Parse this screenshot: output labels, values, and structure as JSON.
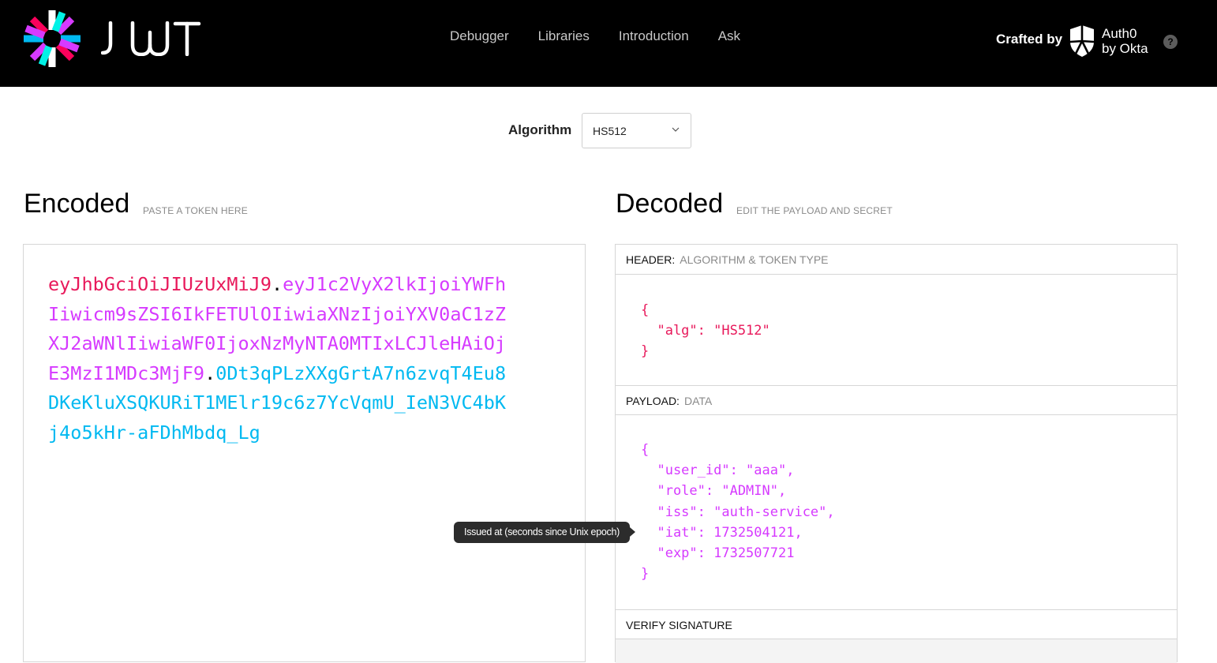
{
  "brand": {
    "wordmark": "JWT"
  },
  "nav": [
    {
      "label": "Debugger"
    },
    {
      "label": "Libraries"
    },
    {
      "label": "Introduction"
    },
    {
      "label": "Ask"
    }
  ],
  "credit": {
    "prefix": "Crafted by",
    "name_line1": "Auth0",
    "name_line2": "by Okta",
    "help": "?"
  },
  "algorithm": {
    "label": "Algorithm",
    "selected": "HS512"
  },
  "encoded": {
    "title": "Encoded",
    "subtitle": "PASTE A TOKEN HERE",
    "token_header": "eyJhbGciOiJIUzUxMiJ9",
    "token_payload": "eyJ1c2VyX2lkIjoiYWFhIiwicm9sZSI6IkFETUlOIiwiaXNzIjoiYXV0aC1zZXJ2aWNlIiwiaWF0IjoxNzMyNTA0MTIxLCJleHAiOjE3MzI1MDc3MjF9",
    "token_signature": "0Dt3qPLzXXgGrtA7n6zvqT4Eu8DKeKluXSQKURiT1MElr19c6z7YcVqmU_IeN3VC4bKj4o5kHr-aFDhMbdq_Lg",
    "separator": "."
  },
  "decoded": {
    "title": "Decoded",
    "subtitle": "EDIT THE PAYLOAD AND SECRET",
    "header_section": {
      "label": "HEADER:",
      "sublabel": "ALGORITHM & TOKEN TYPE",
      "json": "{\n  \"alg\": \"HS512\"\n}"
    },
    "payload_section": {
      "label": "PAYLOAD:",
      "sublabel": "DATA",
      "json": "{\n  \"user_id\": \"aaa\",\n  \"role\": \"ADMIN\",\n  \"iss\": \"auth-service\",\n  \"iat\": 1732504121,\n  \"exp\": 1732507721\n}"
    },
    "verify_section": {
      "label": "VERIFY SIGNATURE"
    }
  },
  "tooltip": {
    "text": "Issued at (seconds since Unix epoch)"
  },
  "colors": {
    "header": "#e8195b",
    "payload": "#d63aff",
    "signature": "#00b9f1"
  }
}
